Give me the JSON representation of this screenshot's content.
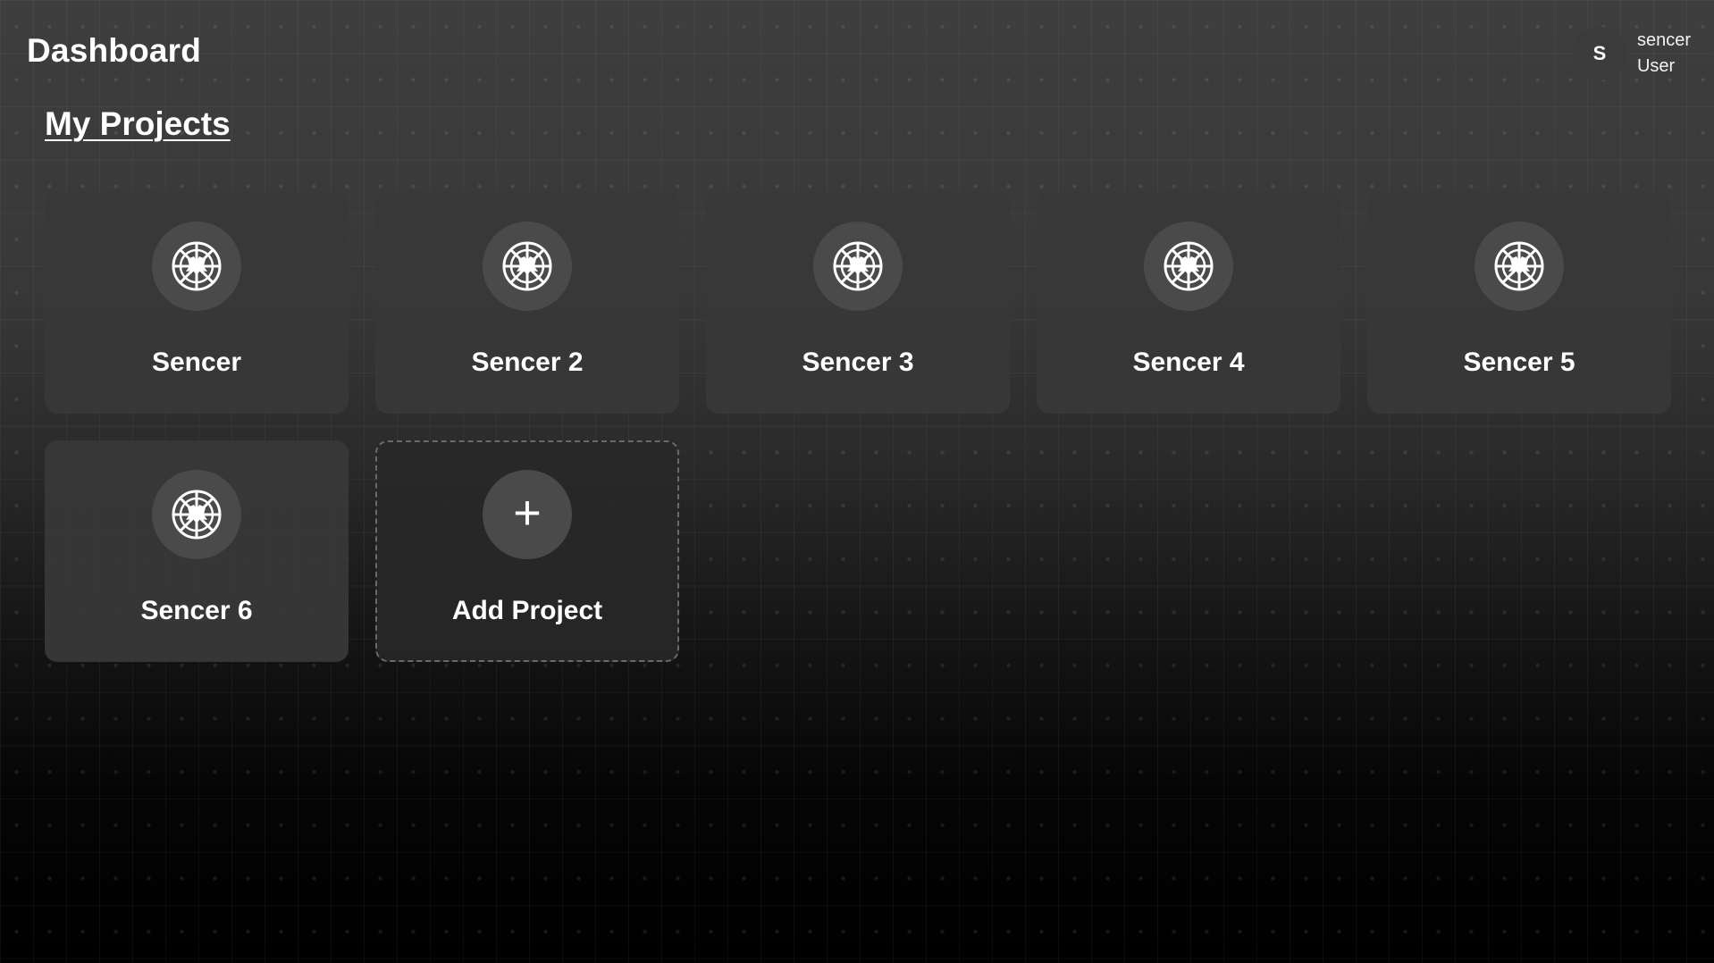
{
  "header": {
    "title": "Dashboard"
  },
  "user": {
    "initial": "S",
    "name": "sencer",
    "role": "User"
  },
  "section": {
    "title": "My Projects"
  },
  "projects": [
    {
      "name": "Sencer",
      "icon": "helm-icon"
    },
    {
      "name": "Sencer 2",
      "icon": "helm-icon"
    },
    {
      "name": "Sencer 3",
      "icon": "helm-icon"
    },
    {
      "name": "Sencer 4",
      "icon": "helm-icon"
    },
    {
      "name": "Sencer 5",
      "icon": "helm-icon"
    },
    {
      "name": "Sencer 6",
      "icon": "helm-icon"
    }
  ],
  "add_project": {
    "label": "Add Project",
    "icon": "plus-icon",
    "glyph": "+"
  }
}
